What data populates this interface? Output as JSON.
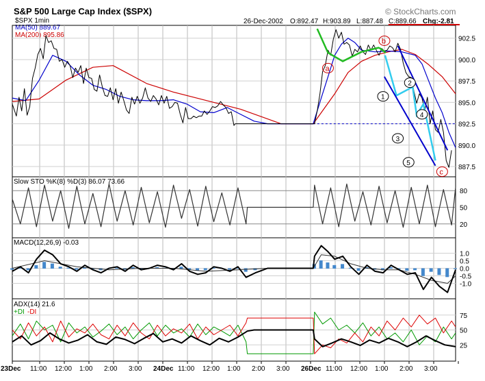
{
  "header": {
    "title": "S&P 500 Large Cap Index ($SPX)",
    "copyright": "© StockCharts.com",
    "symbol_line": "$SPX 1min",
    "ma50": "MA(50) 889.67",
    "ma200": "MA(200) 895.86",
    "date": "26-Dec-2002",
    "open": "O:892.47",
    "high": "H:903.89",
    "low": "L:887.48",
    "close": "C:889.66",
    "change": "Chg:-2.81"
  },
  "colors": {
    "price": "#000000",
    "ma50": "#0000cc",
    "ma200": "#cc0000",
    "green_wave": "#22bb22",
    "cyan_wave": "#33ccee",
    "channel": "#0000cc",
    "annot": "#cc0000",
    "hist": "#4488cc",
    "plus_di": "#009900",
    "minus_di": "#dd0000"
  },
  "panels": {
    "sto": {
      "label": "Slow STO %K(8) %D(3)  86.07  73.66",
      "ticks": [
        "80",
        "50",
        "20"
      ]
    },
    "macd": {
      "label": "MACD(12,26,9)  -0.03",
      "ticks": [
        "1.0",
        "0.5",
        "0.0",
        "-0.5",
        "-1.0"
      ]
    },
    "adx": {
      "label": "ADX(14)  21.6",
      "plus": "+DI",
      "minus": "-DI",
      "ticks": [
        "75",
        "50",
        "25"
      ]
    }
  },
  "annotations": {
    "red": [
      "a",
      "b",
      "c"
    ],
    "black": [
      "1",
      "2",
      "3",
      "4",
      "5"
    ]
  },
  "chart_data": {
    "type": "line",
    "x_labels": [
      "23Dec",
      "11:00",
      "12:00",
      "1:00",
      "2:00",
      "3:00",
      "24Dec",
      "11:00",
      "12:00",
      "1:00",
      "2:00",
      "3:00",
      "26Dec",
      "11:00",
      "12:00",
      "1:00",
      "2:00",
      "3:00"
    ],
    "y_ticks": [
      902.5,
      900.0,
      897.5,
      895.0,
      892.5,
      890.0,
      887.5
    ],
    "ylim": [
      886.3,
      904.0
    ],
    "price": {
      "x": [
        0,
        6,
        10,
        14,
        18,
        22,
        26,
        30,
        34,
        38,
        42,
        46,
        50,
        54,
        58,
        62,
        66,
        70,
        74,
        78,
        82,
        86,
        90,
        94,
        98,
        102,
        106,
        110,
        114,
        118,
        122,
        126,
        130,
        134,
        138,
        142,
        146,
        150,
        154,
        158,
        162,
        166,
        170,
        174,
        178,
        182,
        186,
        190,
        194,
        198,
        202,
        206,
        210,
        214,
        218,
        222,
        226,
        230,
        234,
        238,
        242,
        246,
        250,
        254,
        258,
        262,
        266,
        270,
        274,
        278,
        282,
        286,
        290,
        294,
        298,
        302,
        306,
        310,
        314,
        318,
        322,
        326,
        330,
        332,
        360,
        390,
        420,
        450,
        454,
        458,
        462,
        466,
        470,
        474,
        478,
        482,
        486,
        490,
        494,
        498,
        502,
        506,
        510,
        514,
        518,
        522,
        526,
        530,
        534,
        538,
        542,
        546,
        550,
        554,
        558,
        562,
        566,
        570,
        574,
        578,
        582,
        586,
        590,
        594,
        598,
        602,
        606,
        610,
        614,
        618,
        622,
        626,
        630,
        634,
        638,
        642,
        646,
        650,
        654,
        660
      ],
      "y": [
        894.8,
        893.4,
        895.6,
        894.0,
        896.6,
        893.5,
        894.5,
        897.8,
        899.0,
        900.6,
        901.3,
        900.1,
        902.8,
        902.0,
        902.2,
        901.3,
        901.2,
        899.8,
        900.0,
        899.1,
        899.8,
        899.3,
        897.9,
        899.0,
        898.5,
        899.3,
        897.2,
        899.0,
        897.9,
        897.8,
        896.5,
        896.3,
        898.2,
        896.8,
        895.8,
        895.7,
        896.7,
        895.3,
        896.6,
        894.9,
        896.2,
        895.2,
        894.1,
        893.7,
        895.6,
        894.8,
        895.7,
        894.9,
        895.5,
        896.7,
        895.5,
        895.1,
        895.8,
        895.4,
        894.7,
        895.8,
        894.9,
        895.7,
        894.3,
        894.5,
        895.0,
        894.9,
        893.6,
        892.6,
        894.4,
        893.1,
        893.1,
        893.4,
        893.2,
        893.4,
        893.4,
        894.0,
        893.6,
        894.0,
        894.5,
        894.4,
        894.6,
        895.1,
        894.7,
        894.4,
        893.7,
        893.9,
        892.3,
        892.5,
        892.5,
        892.5,
        892.5,
        892.5,
        894.0,
        896.0,
        898.6,
        899.3,
        901.1,
        900.5,
        902.4,
        903.5,
        902.5,
        903.2,
        901.8,
        902.0,
        901.7,
        900.4,
        901.2,
        900.9,
        901.6,
        900.9,
        900.6,
        901.7,
        901.1,
        901.7,
        901.1,
        900.5,
        901.3,
        901.0,
        901.1,
        901.6,
        901.4,
        900.9,
        901.9,
        901.2,
        899.6,
        898.5,
        898.0,
        897.9,
        896.3,
        894.9,
        896.0,
        895.5,
        894.0,
        895.6,
        892.5,
        894.0,
        891.8,
        891.5,
        893.0,
        891.5,
        888.2,
        887.4,
        889.4
      ]
    },
    "ma50": {
      "x": [
        0,
        20,
        40,
        60,
        80,
        100,
        120,
        140,
        160,
        180,
        200,
        220,
        240,
        260,
        280,
        300,
        320,
        340,
        360,
        380,
        420,
        448,
        460,
        470,
        480,
        490,
        500,
        510,
        520,
        540,
        560,
        580,
        600,
        610,
        620,
        630,
        640,
        650,
        660
      ],
      "y": [
        895.5,
        895.2,
        897.6,
        900.5,
        899.8,
        898.2,
        897.0,
        896.5,
        895.7,
        895.3,
        895.2,
        895.2,
        895.3,
        894.8,
        893.9,
        893.8,
        894.4,
        893.6,
        892.8,
        892.5,
        892.5,
        892.5,
        895.5,
        898.0,
        900.5,
        901.8,
        902.5,
        902.0,
        901.1,
        900.9,
        901.0,
        900.9,
        900.5,
        899.5,
        897.5,
        895.5,
        893.8,
        891.5,
        889.7
      ]
    },
    "ma200": {
      "x": [
        0,
        40,
        80,
        120,
        150,
        200,
        240,
        280,
        300,
        340,
        400,
        448,
        460,
        480,
        500,
        520,
        540,
        560,
        580,
        600,
        620,
        640,
        660
      ],
      "y": [
        895.1,
        895.4,
        897.6,
        899.1,
        899.3,
        897.2,
        896.2,
        895.4,
        895.0,
        894.2,
        892.5,
        892.5,
        893.8,
        896.0,
        898.5,
        899.8,
        900.5,
        900.9,
        901.2,
        900.6,
        899.4,
        898.0,
        896.0
      ]
    },
    "sto_k": {
      "x": [
        0,
        12,
        24,
        36,
        48,
        60,
        72,
        84,
        96,
        108,
        120,
        132,
        144,
        156,
        168,
        180,
        192,
        204,
        216,
        228,
        240,
        252,
        264,
        276,
        288,
        300,
        312,
        324,
        336,
        348,
        350,
        448,
        450,
        462,
        474,
        486,
        498,
        510,
        522,
        534,
        546,
        558,
        570,
        582,
        594,
        606,
        618,
        630,
        642,
        654,
        660
      ],
      "y": [
        65,
        20,
        85,
        15,
        90,
        25,
        80,
        12,
        88,
        20,
        75,
        15,
        92,
        25,
        80,
        18,
        86,
        22,
        78,
        14,
        90,
        30,
        82,
        16,
        88,
        24,
        76,
        18,
        85,
        20,
        50,
        50,
        90,
        20,
        85,
        15,
        92,
        25,
        78,
        18,
        88,
        22,
        80,
        14,
        86,
        20,
        90,
        15,
        82,
        18,
        86
      ]
    },
    "macd": {
      "x": [
        0,
        12,
        24,
        36,
        48,
        60,
        72,
        84,
        96,
        108,
        120,
        132,
        144,
        156,
        168,
        180,
        192,
        204,
        216,
        228,
        240,
        252,
        264,
        276,
        288,
        300,
        312,
        324,
        336,
        348,
        362,
        380,
        448,
        450,
        460,
        470,
        480,
        492,
        504,
        516,
        528,
        540,
        552,
        564,
        576,
        588,
        600,
        612,
        624,
        636,
        648,
        660
      ],
      "y": [
        -0.2,
        0.1,
        -0.3,
        0.6,
        1.2,
        0.9,
        0.3,
        0.1,
        -0.2,
        0.2,
        -0.1,
        -0.3,
        0.0,
        0.1,
        -0.2,
        0.2,
        -0.1,
        0.0,
        0.2,
        0.1,
        -0.1,
        0.3,
        -0.2,
        -0.4,
        -0.3,
        0.1,
        0.0,
        -0.2,
        0.1,
        -0.6,
        -0.3,
        0.0,
        0.0,
        0.8,
        1.5,
        1.1,
        0.6,
        0.8,
        0.1,
        -0.4,
        0.2,
        -0.2,
        -0.3,
        0.2,
        -0.1,
        -0.4,
        -0.3,
        -1.4,
        -0.6,
        -1.2,
        -1.6,
        -0.1
      ]
    },
    "macd_signal": {
      "x": [
        0,
        48,
        96,
        144,
        192,
        240,
        288,
        336,
        380,
        448,
        460,
        480,
        504,
        528,
        552,
        576,
        600,
        624,
        648,
        660
      ],
      "y": [
        0.0,
        0.5,
        0.1,
        -0.1,
        0.0,
        0.0,
        -0.2,
        -0.1,
        0.0,
        0.0,
        0.9,
        0.8,
        0.3,
        0.0,
        -0.1,
        -0.1,
        -0.4,
        -0.8,
        -1.0,
        -0.5
      ]
    },
    "adx": {
      "x": [
        0,
        14,
        28,
        42,
        56,
        70,
        84,
        98,
        112,
        126,
        140,
        154,
        168,
        182,
        196,
        210,
        224,
        238,
        252,
        266,
        280,
        294,
        308,
        322,
        336,
        350,
        360,
        448,
        450,
        462,
        476,
        490,
        504,
        518,
        532,
        546,
        560,
        574,
        588,
        602,
        616,
        630,
        644,
        660
      ],
      "y": [
        30,
        40,
        25,
        32,
        45,
        35,
        28,
        33,
        42,
        30,
        26,
        38,
        34,
        27,
        36,
        44,
        30,
        35,
        28,
        40,
        32,
        25,
        36,
        30,
        38,
        48,
        50,
        50,
        35,
        22,
        28,
        35,
        30,
        24,
        33,
        28,
        36,
        30,
        22,
        30,
        40,
        32,
        25,
        22
      ]
    },
    "plus_di": {
      "x": [
        0,
        12,
        24,
        36,
        48,
        60,
        72,
        84,
        96,
        108,
        120,
        132,
        144,
        156,
        168,
        180,
        192,
        204,
        216,
        228,
        240,
        252,
        264,
        276,
        288,
        300,
        312,
        324,
        336,
        348,
        350,
        448,
        450,
        462,
        474,
        486,
        498,
        510,
        522,
        534,
        546,
        558,
        570,
        582,
        594,
        606,
        618,
        630,
        642,
        654,
        660
      ],
      "y": [
        40,
        60,
        35,
        65,
        50,
        58,
        30,
        62,
        45,
        55,
        38,
        48,
        60,
        42,
        55,
        35,
        50,
        62,
        40,
        58,
        45,
        52,
        38,
        60,
        42,
        55,
        48,
        40,
        58,
        30,
        10,
        10,
        80,
        60,
        70,
        50,
        58,
        45,
        62,
        40,
        55,
        35,
        45,
        30,
        50,
        25,
        40,
        30,
        55,
        35,
        45
      ]
    },
    "minus_di": {
      "x": [
        0,
        12,
        24,
        36,
        48,
        60,
        72,
        84,
        96,
        108,
        120,
        132,
        144,
        156,
        168,
        180,
        192,
        204,
        216,
        228,
        240,
        252,
        264,
        276,
        288,
        300,
        312,
        324,
        336,
        348,
        350,
        448,
        450,
        462,
        474,
        486,
        498,
        510,
        522,
        534,
        546,
        558,
        570,
        582,
        594,
        606,
        618,
        630,
        642,
        654,
        660
      ],
      "y": [
        50,
        35,
        62,
        40,
        55,
        30,
        65,
        38,
        52,
        45,
        60,
        42,
        35,
        58,
        40,
        62,
        45,
        35,
        58,
        40,
        52,
        45,
        60,
        35,
        55,
        42,
        50,
        58,
        40,
        62,
        70,
        70,
        10,
        25,
        20,
        35,
        28,
        45,
        30,
        55,
        40,
        65,
        50,
        70,
        55,
        75,
        60,
        70,
        45,
        65,
        55
      ]
    }
  }
}
